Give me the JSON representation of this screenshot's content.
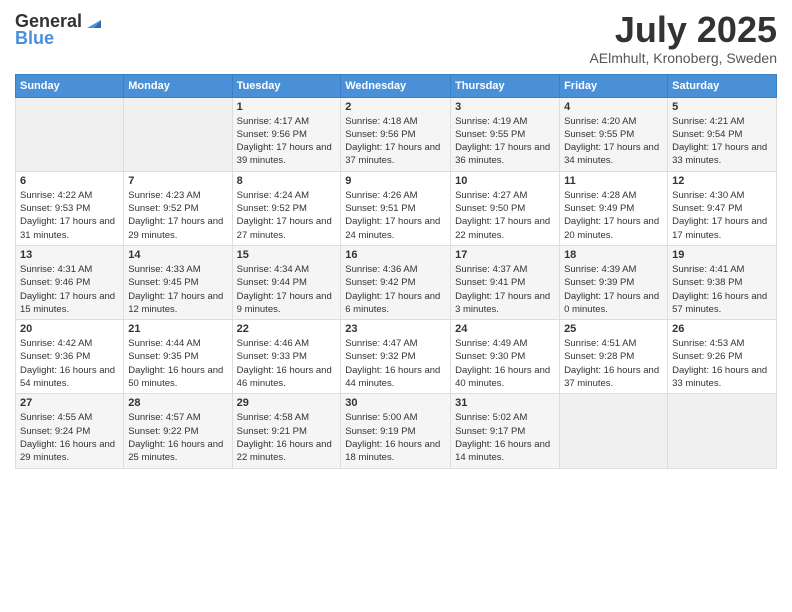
{
  "header": {
    "logo_general": "General",
    "logo_blue": "Blue",
    "title": "July 2025",
    "location": "AElmhult, Kronoberg, Sweden"
  },
  "weekdays": [
    "Sunday",
    "Monday",
    "Tuesday",
    "Wednesday",
    "Thursday",
    "Friday",
    "Saturday"
  ],
  "weeks": [
    [
      {
        "day": "",
        "sunrise": "",
        "sunset": "",
        "daylight": ""
      },
      {
        "day": "",
        "sunrise": "",
        "sunset": "",
        "daylight": ""
      },
      {
        "day": "1",
        "sunrise": "Sunrise: 4:17 AM",
        "sunset": "Sunset: 9:56 PM",
        "daylight": "Daylight: 17 hours and 39 minutes."
      },
      {
        "day": "2",
        "sunrise": "Sunrise: 4:18 AM",
        "sunset": "Sunset: 9:56 PM",
        "daylight": "Daylight: 17 hours and 37 minutes."
      },
      {
        "day": "3",
        "sunrise": "Sunrise: 4:19 AM",
        "sunset": "Sunset: 9:55 PM",
        "daylight": "Daylight: 17 hours and 36 minutes."
      },
      {
        "day": "4",
        "sunrise": "Sunrise: 4:20 AM",
        "sunset": "Sunset: 9:55 PM",
        "daylight": "Daylight: 17 hours and 34 minutes."
      },
      {
        "day": "5",
        "sunrise": "Sunrise: 4:21 AM",
        "sunset": "Sunset: 9:54 PM",
        "daylight": "Daylight: 17 hours and 33 minutes."
      }
    ],
    [
      {
        "day": "6",
        "sunrise": "Sunrise: 4:22 AM",
        "sunset": "Sunset: 9:53 PM",
        "daylight": "Daylight: 17 hours and 31 minutes."
      },
      {
        "day": "7",
        "sunrise": "Sunrise: 4:23 AM",
        "sunset": "Sunset: 9:52 PM",
        "daylight": "Daylight: 17 hours and 29 minutes."
      },
      {
        "day": "8",
        "sunrise": "Sunrise: 4:24 AM",
        "sunset": "Sunset: 9:52 PM",
        "daylight": "Daylight: 17 hours and 27 minutes."
      },
      {
        "day": "9",
        "sunrise": "Sunrise: 4:26 AM",
        "sunset": "Sunset: 9:51 PM",
        "daylight": "Daylight: 17 hours and 24 minutes."
      },
      {
        "day": "10",
        "sunrise": "Sunrise: 4:27 AM",
        "sunset": "Sunset: 9:50 PM",
        "daylight": "Daylight: 17 hours and 22 minutes."
      },
      {
        "day": "11",
        "sunrise": "Sunrise: 4:28 AM",
        "sunset": "Sunset: 9:49 PM",
        "daylight": "Daylight: 17 hours and 20 minutes."
      },
      {
        "day": "12",
        "sunrise": "Sunrise: 4:30 AM",
        "sunset": "Sunset: 9:47 PM",
        "daylight": "Daylight: 17 hours and 17 minutes."
      }
    ],
    [
      {
        "day": "13",
        "sunrise": "Sunrise: 4:31 AM",
        "sunset": "Sunset: 9:46 PM",
        "daylight": "Daylight: 17 hours and 15 minutes."
      },
      {
        "day": "14",
        "sunrise": "Sunrise: 4:33 AM",
        "sunset": "Sunset: 9:45 PM",
        "daylight": "Daylight: 17 hours and 12 minutes."
      },
      {
        "day": "15",
        "sunrise": "Sunrise: 4:34 AM",
        "sunset": "Sunset: 9:44 PM",
        "daylight": "Daylight: 17 hours and 9 minutes."
      },
      {
        "day": "16",
        "sunrise": "Sunrise: 4:36 AM",
        "sunset": "Sunset: 9:42 PM",
        "daylight": "Daylight: 17 hours and 6 minutes."
      },
      {
        "day": "17",
        "sunrise": "Sunrise: 4:37 AM",
        "sunset": "Sunset: 9:41 PM",
        "daylight": "Daylight: 17 hours and 3 minutes."
      },
      {
        "day": "18",
        "sunrise": "Sunrise: 4:39 AM",
        "sunset": "Sunset: 9:39 PM",
        "daylight": "Daylight: 17 hours and 0 minutes."
      },
      {
        "day": "19",
        "sunrise": "Sunrise: 4:41 AM",
        "sunset": "Sunset: 9:38 PM",
        "daylight": "Daylight: 16 hours and 57 minutes."
      }
    ],
    [
      {
        "day": "20",
        "sunrise": "Sunrise: 4:42 AM",
        "sunset": "Sunset: 9:36 PM",
        "daylight": "Daylight: 16 hours and 54 minutes."
      },
      {
        "day": "21",
        "sunrise": "Sunrise: 4:44 AM",
        "sunset": "Sunset: 9:35 PM",
        "daylight": "Daylight: 16 hours and 50 minutes."
      },
      {
        "day": "22",
        "sunrise": "Sunrise: 4:46 AM",
        "sunset": "Sunset: 9:33 PM",
        "daylight": "Daylight: 16 hours and 46 minutes."
      },
      {
        "day": "23",
        "sunrise": "Sunrise: 4:47 AM",
        "sunset": "Sunset: 9:32 PM",
        "daylight": "Daylight: 16 hours and 44 minutes."
      },
      {
        "day": "24",
        "sunrise": "Sunrise: 4:49 AM",
        "sunset": "Sunset: 9:30 PM",
        "daylight": "Daylight: 16 hours and 40 minutes."
      },
      {
        "day": "25",
        "sunrise": "Sunrise: 4:51 AM",
        "sunset": "Sunset: 9:28 PM",
        "daylight": "Daylight: 16 hours and 37 minutes."
      },
      {
        "day": "26",
        "sunrise": "Sunrise: 4:53 AM",
        "sunset": "Sunset: 9:26 PM",
        "daylight": "Daylight: 16 hours and 33 minutes."
      }
    ],
    [
      {
        "day": "27",
        "sunrise": "Sunrise: 4:55 AM",
        "sunset": "Sunset: 9:24 PM",
        "daylight": "Daylight: 16 hours and 29 minutes."
      },
      {
        "day": "28",
        "sunrise": "Sunrise: 4:57 AM",
        "sunset": "Sunset: 9:22 PM",
        "daylight": "Daylight: 16 hours and 25 minutes."
      },
      {
        "day": "29",
        "sunrise": "Sunrise: 4:58 AM",
        "sunset": "Sunset: 9:21 PM",
        "daylight": "Daylight: 16 hours and 22 minutes."
      },
      {
        "day": "30",
        "sunrise": "Sunrise: 5:00 AM",
        "sunset": "Sunset: 9:19 PM",
        "daylight": "Daylight: 16 hours and 18 minutes."
      },
      {
        "day": "31",
        "sunrise": "Sunrise: 5:02 AM",
        "sunset": "Sunset: 9:17 PM",
        "daylight": "Daylight: 16 hours and 14 minutes."
      },
      {
        "day": "",
        "sunrise": "",
        "sunset": "",
        "daylight": ""
      },
      {
        "day": "",
        "sunrise": "",
        "sunset": "",
        "daylight": ""
      }
    ]
  ]
}
